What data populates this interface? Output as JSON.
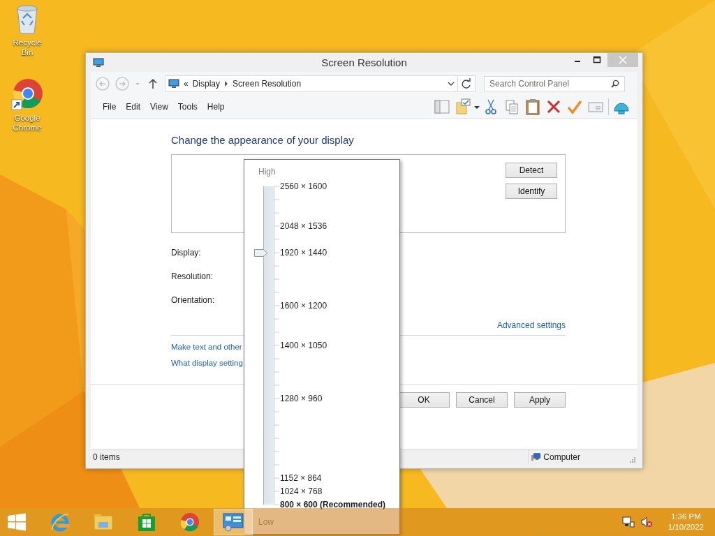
{
  "desktop_icons": [
    {
      "kind": "recycle",
      "label": "Recycle Bin"
    },
    {
      "kind": "chrome",
      "label": "Google Chrome"
    }
  ],
  "window": {
    "title": "Screen Resolution",
    "address": {
      "prefix": "«",
      "items": [
        "Display",
        "Screen Resolution"
      ]
    },
    "search": {
      "placeholder": "Search Control Panel"
    },
    "menu": [
      "File",
      "Edit",
      "View",
      "Tools",
      "Help"
    ],
    "heading": "Change the appearance of your display",
    "monitor_buttons": [
      "Detect",
      "Identify"
    ],
    "fields": [
      "Display:",
      "Resolution:",
      "Orientation:"
    ],
    "advanced_link": "Advanced settings",
    "links": [
      "Make text and other",
      "What display setting"
    ],
    "buttons": [
      "OK",
      "Cancel",
      "Apply"
    ],
    "status_bar": {
      "items": "0 items",
      "zone": "Computer"
    }
  },
  "resolution_popup": {
    "high": "High",
    "low": "Low",
    "level": 0.7917,
    "options": [
      {
        "label": "2560 × 1600",
        "recommended": false
      },
      {
        "label": "2048 × 1536",
        "recommended": false
      },
      {
        "label": "1920 × 1440",
        "recommended": false
      },
      {
        "label": "1600 × 1200",
        "recommended": false
      },
      {
        "label": "1400 × 1050",
        "recommended": false
      },
      {
        "label": "1280 × 960",
        "recommended": false
      },
      {
        "label": "1152 × 864",
        "recommended": false
      },
      {
        "label": "1024 × 768",
        "recommended": false
      },
      {
        "label": "800 × 600 (Recommended)",
        "recommended": true
      }
    ]
  },
  "taskbar": {
    "apps": [
      {
        "kind": "ie",
        "selected": false
      },
      {
        "kind": "explorer",
        "selected": false
      },
      {
        "kind": "store",
        "selected": false
      },
      {
        "kind": "chrome",
        "selected": false
      },
      {
        "kind": "control-panel",
        "selected": true
      }
    ],
    "volume_muted": true,
    "time": "1:36 PM",
    "date": "1/10/2022"
  }
}
